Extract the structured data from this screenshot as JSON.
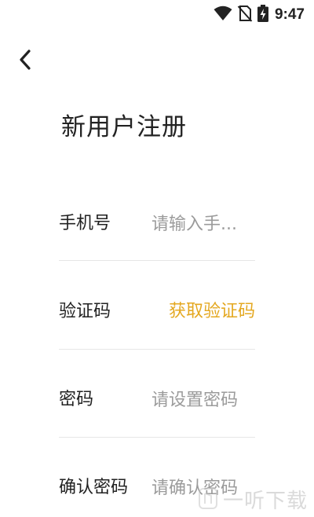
{
  "status_bar": {
    "time": "9:47",
    "icons": [
      "wifi-icon",
      "no-sim-icon",
      "battery-charging-icon"
    ]
  },
  "header": {
    "back_icon": "chevron-left-icon",
    "title": "新用户注册"
  },
  "form": {
    "phone": {
      "label": "手机号",
      "placeholder": "请输入手..."
    },
    "code": {
      "label": "验证码",
      "get_code_label": "获取验证码"
    },
    "password": {
      "label": "密码",
      "placeholder": "请设置密码"
    },
    "confirm_password": {
      "label": "确认密码",
      "placeholder": "请确认密码"
    }
  },
  "watermark": {
    "text": "一听下载"
  },
  "colors": {
    "accent": "#e4a821",
    "placeholder": "#9b9b9b",
    "divider": "#e6e6e6",
    "text": "#222222"
  }
}
